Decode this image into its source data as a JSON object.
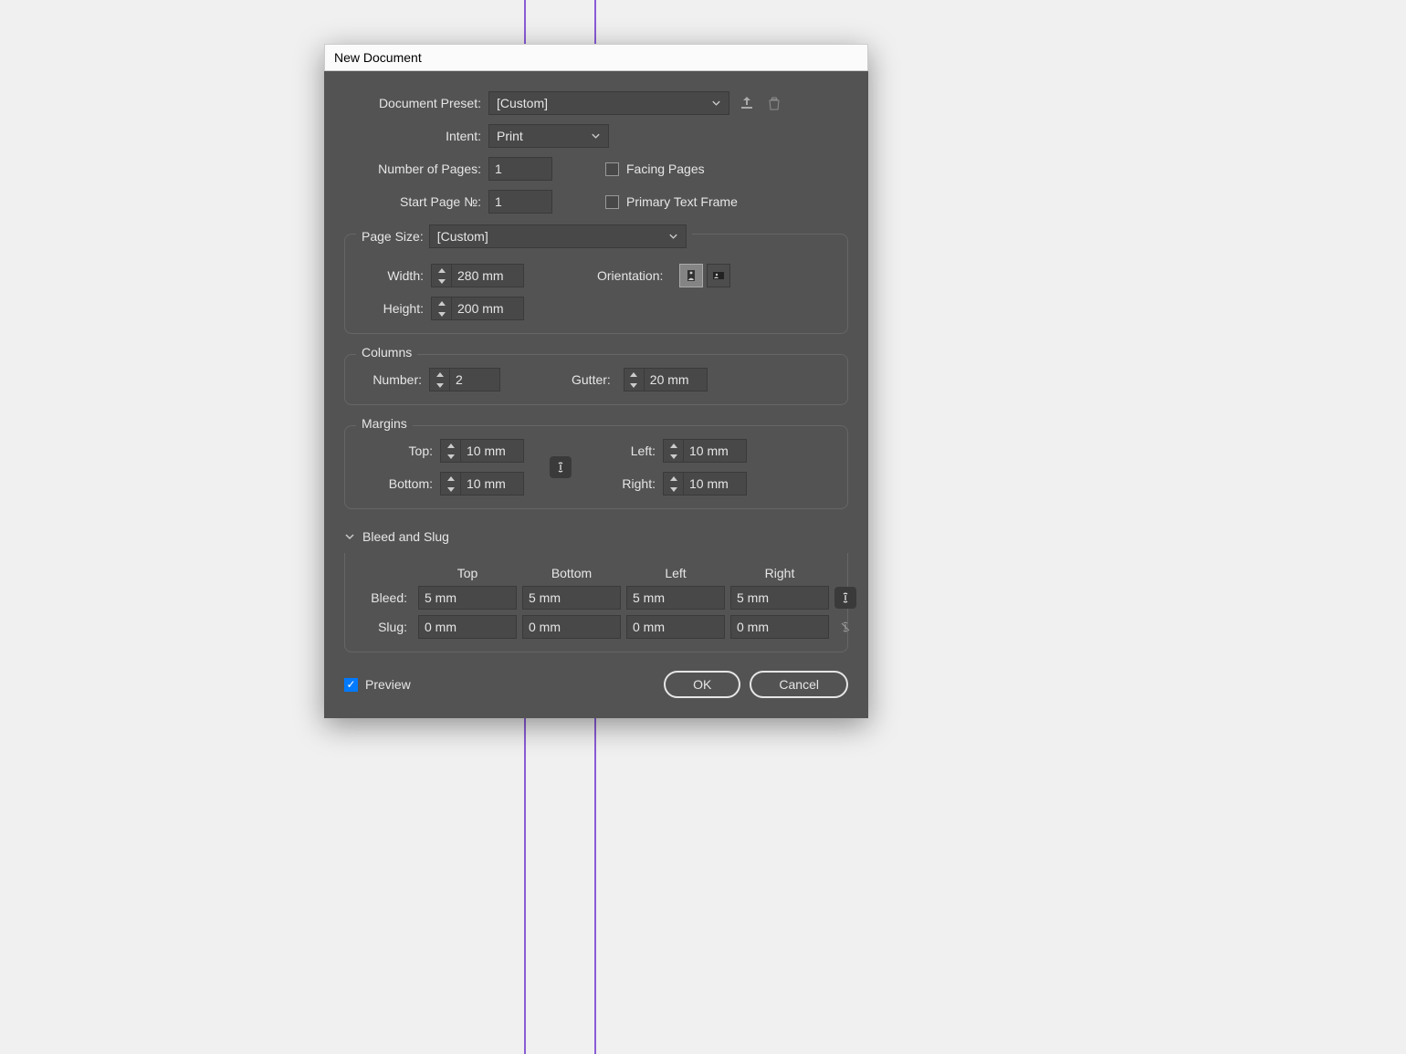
{
  "window": {
    "title": "New Document"
  },
  "preset": {
    "label": "Document Preset:",
    "value": "[Custom]"
  },
  "intent": {
    "label": "Intent:",
    "value": "Print"
  },
  "pages": {
    "label": "Number of Pages:",
    "value": "1"
  },
  "startPage": {
    "label": "Start Page №:",
    "value": "1"
  },
  "facingPages": {
    "label": "Facing Pages",
    "checked": false
  },
  "primaryTextFrame": {
    "label": "Primary Text Frame",
    "checked": false
  },
  "pageSize": {
    "legend": "Page Size:",
    "value": "[Custom]",
    "width": {
      "label": "Width:",
      "value": "280 mm"
    },
    "height": {
      "label": "Height:",
      "value": "200 mm"
    },
    "orientation": {
      "label": "Orientation:"
    }
  },
  "columns": {
    "legend": "Columns",
    "number": {
      "label": "Number:",
      "value": "2"
    },
    "gutter": {
      "label": "Gutter:",
      "value": "20 mm"
    }
  },
  "margins": {
    "legend": "Margins",
    "top": {
      "label": "Top:",
      "value": "10 mm"
    },
    "bottom": {
      "label": "Bottom:",
      "value": "10 mm"
    },
    "left": {
      "label": "Left:",
      "value": "10 mm"
    },
    "right": {
      "label": "Right:",
      "value": "10 mm"
    }
  },
  "bleedSlug": {
    "title": "Bleed and Slug",
    "headers": {
      "top": "Top",
      "bottom": "Bottom",
      "left": "Left",
      "right": "Right"
    },
    "bleed": {
      "label": "Bleed:",
      "top": "5 mm",
      "bottom": "5 mm",
      "left": "5 mm",
      "right": "5 mm"
    },
    "slug": {
      "label": "Slug:",
      "top": "0 mm",
      "bottom": "0 mm",
      "left": "0 mm",
      "right": "0 mm"
    }
  },
  "footer": {
    "preview": "Preview",
    "ok": "OK",
    "cancel": "Cancel"
  }
}
